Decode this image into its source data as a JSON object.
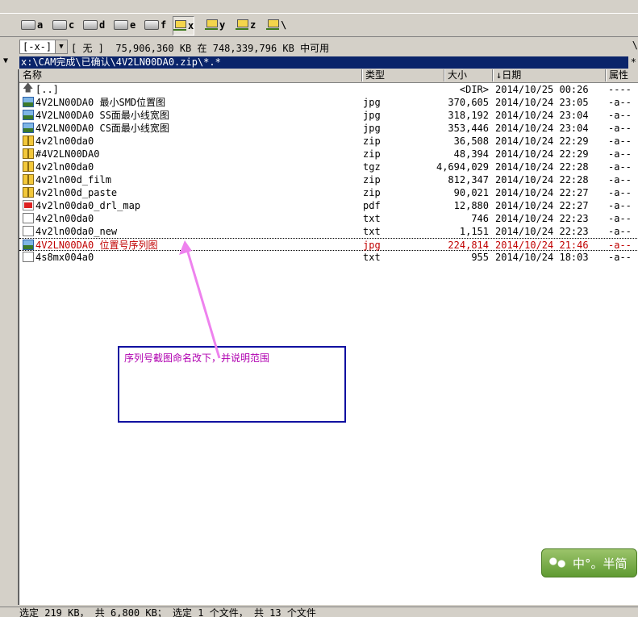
{
  "drives": [
    {
      "label": "a",
      "type": "floppy"
    },
    {
      "label": "c",
      "type": "disk"
    },
    {
      "label": "d",
      "type": "disk"
    },
    {
      "label": "e",
      "type": "disk"
    },
    {
      "label": "f",
      "type": "disk"
    },
    {
      "label": "x",
      "type": "net",
      "active": true
    },
    {
      "label": "y",
      "type": "net"
    },
    {
      "label": "z",
      "type": "net"
    },
    {
      "label": "\\",
      "type": "root"
    }
  ],
  "info": {
    "drive_select": "[-x-]",
    "free_text": "[ 无 ]  75,906,360 KB 在 748,339,796 KB 中可用",
    "right_sep": "\\"
  },
  "path": {
    "current": "x:\\CAM完成\\已确认\\4V2LN00DA0.zip\\*.*",
    "left_arrow": "▼",
    "right_arrow": "*"
  },
  "columns": {
    "name": "名称",
    "type": "类型",
    "size": "大小",
    "date": "↓日期",
    "attr": "属性"
  },
  "files": [
    {
      "icon": "up-folder-icon",
      "name": "[..]",
      "type": "",
      "size": "<DIR>",
      "date": "2014/10/25 00:26",
      "attr": "----"
    },
    {
      "icon": "image-file-icon",
      "name": "4V2LN00DA0 最小SMD位置图",
      "type": "jpg",
      "size": "370,605",
      "date": "2014/10/24 23:05",
      "attr": "-a--"
    },
    {
      "icon": "image-file-icon",
      "name": "4V2LN00DA0 SS面最小线宽图",
      "type": "jpg",
      "size": "318,192",
      "date": "2014/10/24 23:04",
      "attr": "-a--"
    },
    {
      "icon": "image-file-icon",
      "name": "4V2LN00DA0 CS面最小线宽图",
      "type": "jpg",
      "size": "353,446",
      "date": "2014/10/24 23:04",
      "attr": "-a--"
    },
    {
      "icon": "archive-file-icon",
      "name": "4v2ln00da0",
      "type": "zip",
      "size": "36,508",
      "date": "2014/10/24 22:29",
      "attr": "-a--"
    },
    {
      "icon": "archive-file-icon",
      "name": "#4V2LN00DA0",
      "type": "zip",
      "size": "48,394",
      "date": "2014/10/24 22:29",
      "attr": "-a--"
    },
    {
      "icon": "archive-file-icon",
      "name": "4v2ln00da0",
      "type": "tgz",
      "size": "4,694,029",
      "date": "2014/10/24 22:28",
      "attr": "-a--"
    },
    {
      "icon": "archive-file-icon",
      "name": "4v2ln00d_film",
      "type": "zip",
      "size": "812,347",
      "date": "2014/10/24 22:28",
      "attr": "-a--"
    },
    {
      "icon": "archive-file-icon",
      "name": "4v2ln00d_paste",
      "type": "zip",
      "size": "90,021",
      "date": "2014/10/24 22:27",
      "attr": "-a--"
    },
    {
      "icon": "pdf-file-icon",
      "name": "4v2ln00da0_drl_map",
      "type": "pdf",
      "size": "12,880",
      "date": "2014/10/24 22:27",
      "attr": "-a--"
    },
    {
      "icon": "text-file-icon",
      "name": "4v2ln00da0",
      "type": "txt",
      "size": "746",
      "date": "2014/10/24 22:23",
      "attr": "-a--"
    },
    {
      "icon": "text-file-icon",
      "name": "4v2ln00da0_new",
      "type": "txt",
      "size": "1,151",
      "date": "2014/10/24 22:23",
      "attr": "-a--"
    },
    {
      "icon": "image-file-icon",
      "name": "4V2LN00DA0 位置号序列图",
      "type": "jpg",
      "size": "224,814",
      "date": "2014/10/24 21:46",
      "attr": "-a--",
      "selected": true
    },
    {
      "icon": "text-file-icon",
      "name": "4s8mx004a0",
      "type": "txt",
      "size": "955",
      "date": "2014/10/24 18:03",
      "attr": "-a--"
    }
  ],
  "annotation": {
    "text": "序列号截图命名改下，并说明范围",
    "border_color": "#1010a0",
    "text_color": "#b000b0",
    "arrow_color": "#ee82ee"
  },
  "ime": {
    "label": "中°。半简"
  },
  "status": {
    "text": "选定 219 KB， 共 6,800 KB； 选定 1 个文件， 共 13 个文件"
  },
  "colors": {
    "path_bar_bg": "#0a246a",
    "selected_text": "#c00000"
  }
}
